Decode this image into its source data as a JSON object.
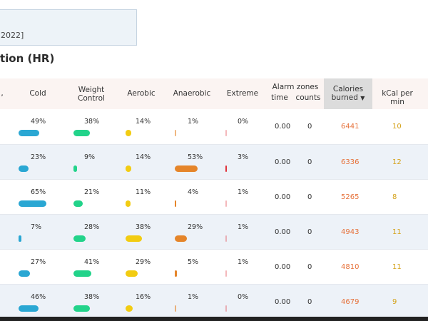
{
  "info_box": {
    "date_text": "2022]"
  },
  "section_title": "tion (HR)",
  "headers": {
    "edge": ",",
    "cold": "Cold",
    "weight_control_1": "Weight",
    "weight_control_2": "Control",
    "aerobic": "Aerobic",
    "anaerobic": "Anaerobic",
    "extreme": "Extreme",
    "alarm_zones": "Alarm zones",
    "time": "time",
    "counts": "counts",
    "calories_1": "Calories",
    "calories_2": "burned",
    "sort_arrow": "▼",
    "kcal": "kCal per min"
  },
  "colors": {
    "cold": "#2aa7d3",
    "weight_control": "#22d38a",
    "aerobic": "#f2cc12",
    "anaerobic": "#e5852a",
    "extreme": "#e0333c",
    "calories": "#e6713a",
    "kcal": "#d4a21a"
  },
  "rows": [
    {
      "cold": "49%",
      "cold_v": 0.49,
      "wc": "38%",
      "wc_v": 0.38,
      "aer": "14%",
      "aer_v": 0.14,
      "ana": "1%",
      "ana_v": 0.01,
      "ext": "0%",
      "ext_v": 0.0,
      "time": "0.00",
      "counts": "0",
      "calories": "6441",
      "kcal": "10"
    },
    {
      "cold": "23%",
      "cold_v": 0.23,
      "wc": "9%",
      "wc_v": 0.09,
      "aer": "14%",
      "aer_v": 0.14,
      "ana": "53%",
      "ana_v": 0.53,
      "ext": "3%",
      "ext_v": 0.03,
      "time": "0.00",
      "counts": "0",
      "calories": "6336",
      "kcal": "12"
    },
    {
      "cold": "65%",
      "cold_v": 0.65,
      "wc": "21%",
      "wc_v": 0.21,
      "aer": "11%",
      "aer_v": 0.11,
      "ana": "4%",
      "ana_v": 0.04,
      "ext": "1%",
      "ext_v": 0.01,
      "time": "0.00",
      "counts": "0",
      "calories": "5265",
      "kcal": "8"
    },
    {
      "cold": "7%",
      "cold_v": 0.07,
      "wc": "28%",
      "wc_v": 0.28,
      "aer": "38%",
      "aer_v": 0.38,
      "ana": "29%",
      "ana_v": 0.29,
      "ext": "1%",
      "ext_v": 0.01,
      "time": "0.00",
      "counts": "0",
      "calories": "4943",
      "kcal": "11"
    },
    {
      "cold": "27%",
      "cold_v": 0.27,
      "wc": "41%",
      "wc_v": 0.41,
      "aer": "29%",
      "aer_v": 0.29,
      "ana": "5%",
      "ana_v": 0.05,
      "ext": "1%",
      "ext_v": 0.01,
      "time": "0.00",
      "counts": "0",
      "calories": "4810",
      "kcal": "11"
    },
    {
      "cold": "46%",
      "cold_v": 0.46,
      "wc": "38%",
      "wc_v": 0.38,
      "aer": "16%",
      "aer_v": 0.16,
      "ana": "1%",
      "ana_v": 0.01,
      "ext": "0%",
      "ext_v": 0.0,
      "time": "0.00",
      "counts": "0",
      "calories": "4679",
      "kcal": "9"
    }
  ]
}
